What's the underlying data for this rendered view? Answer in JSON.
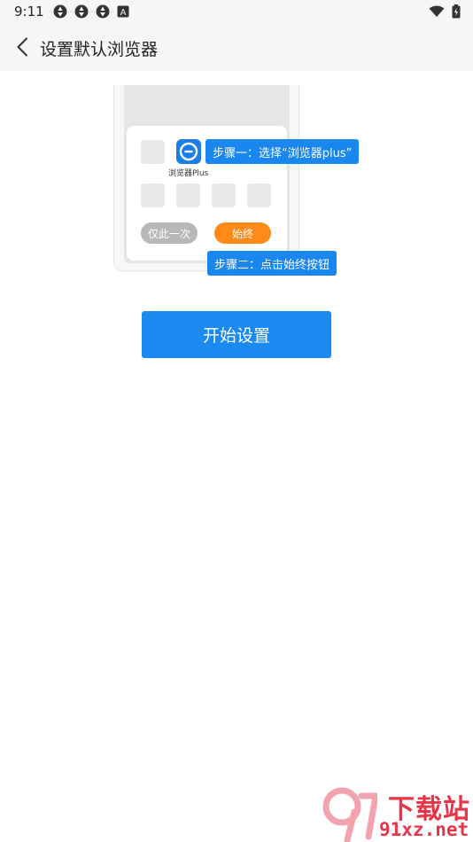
{
  "status_bar": {
    "time": "9:11",
    "left_icons": [
      "aperture-icon",
      "aperture-icon",
      "aperture-icon",
      "a-box-icon"
    ],
    "right_icons": [
      "wifi-icon",
      "battery-icon"
    ]
  },
  "app_bar": {
    "back_icon": "chevron-left-icon",
    "title": "设置默认浏览器"
  },
  "illustration": {
    "app_label": "浏览器Plus",
    "btn_once": "仅此一次",
    "btn_always": "始终",
    "tip_step1": "步骤一：选择“浏览器plus”",
    "tip_step2": "步骤二：点击始终按钮"
  },
  "start_button": "开始设置",
  "watermark": {
    "title": "下载站",
    "url": "91xz.net"
  },
  "colors": {
    "accent_blue": "#1a8af0",
    "orange": "#ff8a1a",
    "gray_button": "#b8b8b8",
    "watermark_red": "#e8354a"
  }
}
